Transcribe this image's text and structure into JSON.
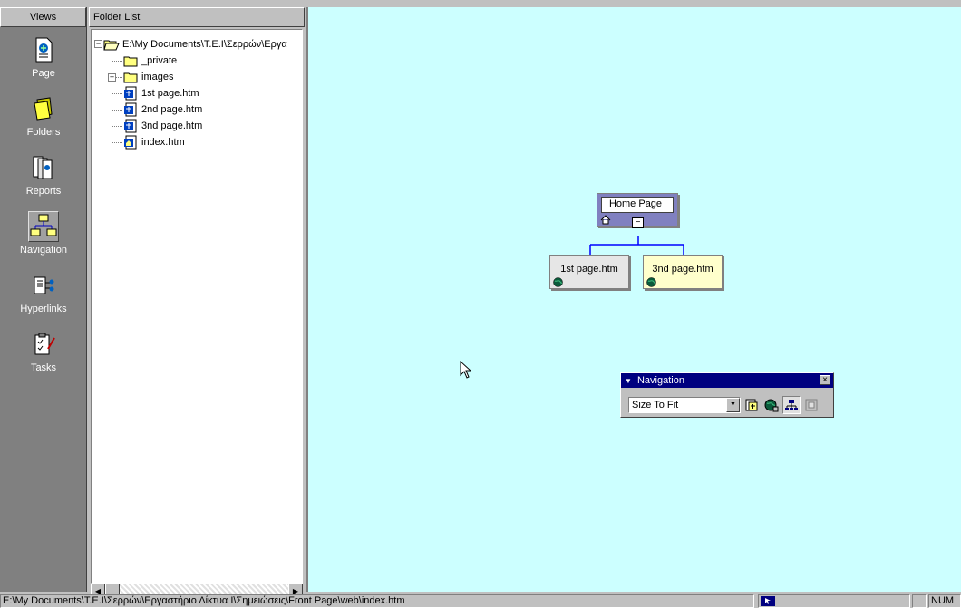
{
  "views": {
    "header": "Views",
    "items": [
      {
        "label": "Page",
        "icon": "page-view-icon"
      },
      {
        "label": "Folders",
        "icon": "folders-view-icon"
      },
      {
        "label": "Reports",
        "icon": "reports-view-icon"
      },
      {
        "label": "Navigation",
        "icon": "navigation-view-icon"
      },
      {
        "label": "Hyperlinks",
        "icon": "hyperlinks-view-icon"
      },
      {
        "label": "Tasks",
        "icon": "tasks-view-icon"
      }
    ],
    "active": "Navigation"
  },
  "folder_list": {
    "header": "Folder List",
    "root": "E:\\My Documents\\T.E.I\\Σερρών\\Εργα",
    "items": [
      {
        "label": "_private",
        "icon": "folder-icon"
      },
      {
        "label": "images",
        "icon": "folder-icon"
      },
      {
        "label": "1st page.htm",
        "icon": "html-page-icon"
      },
      {
        "label": "2nd page.htm",
        "icon": "html-page-icon"
      },
      {
        "label": "3nd page.htm",
        "icon": "html-page-icon"
      },
      {
        "label": "index.htm",
        "icon": "home-page-icon"
      }
    ]
  },
  "navigation_view": {
    "home": "Home Page",
    "children": [
      "1st page.htm",
      "3nd page.htm"
    ]
  },
  "nav_toolbar": {
    "title": "Navigation",
    "zoom": "Size To Fit"
  },
  "status_bar": {
    "path": "E:\\My Documents\\T.E.I\\Σερρών\\Εργαστήριο Δίκτυα Ι\\Σημειώσεις\\Front Page\\web\\index.htm",
    "mode": "NUM"
  },
  "colors": {
    "canvas": "#ccffff",
    "home_box": "#8080c0",
    "child_box_1": "#e6e6e6",
    "child_box_2": "#ffffcc",
    "connector": "#0000ff",
    "title_bar": "#000080"
  }
}
